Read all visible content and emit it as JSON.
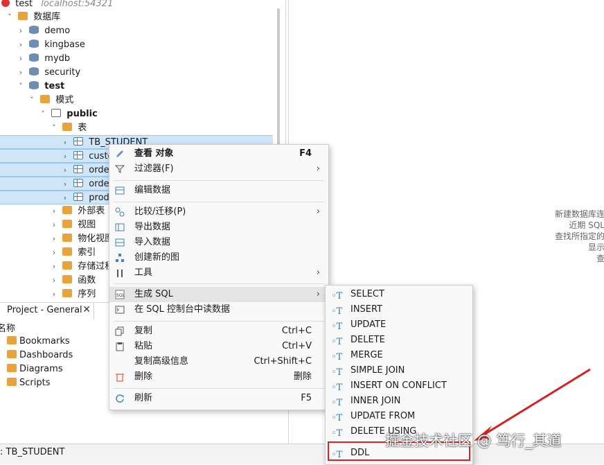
{
  "navigator": {
    "connection": {
      "name": "test",
      "host": "localhost:54321"
    },
    "databases_label": "数据库",
    "databases": [
      "demo",
      "kingbase",
      "mydb",
      "security"
    ],
    "active_db": "test",
    "schemas_label": "模式",
    "schema": "public",
    "tables_label": "表",
    "tables": [
      "TB_STUDENT",
      "custo",
      "order",
      "order",
      "produ"
    ],
    "folders": [
      "外部表",
      "视图",
      "物化视图",
      "索引",
      "存储过程",
      "函数",
      "序列"
    ]
  },
  "editor": {
    "hint_lines": [
      "新建数据库连",
      "近期 SQL",
      "查找所指定的",
      "显示",
      "查"
    ]
  },
  "project": {
    "tab_label": "Project - General",
    "column_header": "名称",
    "items": [
      "Bookmarks",
      "Dashboards",
      "Diagrams",
      "Scripts"
    ]
  },
  "status": {
    "text": ": TB_STUDENT"
  },
  "context_menu": {
    "view_object": {
      "label": "查看 对象",
      "key": "F4"
    },
    "filter": "过滤器(F)",
    "edit_data": "编辑数据",
    "compare": "比较/迁移(P)",
    "export": "导出数据",
    "import": "导入数据",
    "create_diagram": "创建新的图",
    "tools": "工具",
    "generate_sql": "生成 SQL",
    "read_in_console": "在 SQL 控制台中读数据",
    "copy": {
      "label": "复制",
      "key": "Ctrl+C"
    },
    "paste": {
      "label": "粘贴",
      "key": "Ctrl+V"
    },
    "copy_advanced": {
      "label": "复制高级信息",
      "key": "Ctrl+Shift+C"
    },
    "delete": {
      "label": "删除",
      "key": "删除"
    },
    "refresh": {
      "label": "刷新",
      "key": "F5"
    }
  },
  "submenu": {
    "items": [
      "SELECT",
      "INSERT",
      "UPDATE",
      "DELETE",
      "MERGE",
      "SIMPLE JOIN",
      "INSERT ON CONFLICT",
      "INNER JOIN",
      "UPDATE FROM",
      "DELETE USING",
      "DDL"
    ]
  },
  "watermark": "掘金技术社区 @ 笃行_其道",
  "colors": {
    "selection": "#cfe6f8",
    "highlight_box": "#e02020",
    "arrow": "#d42020"
  }
}
